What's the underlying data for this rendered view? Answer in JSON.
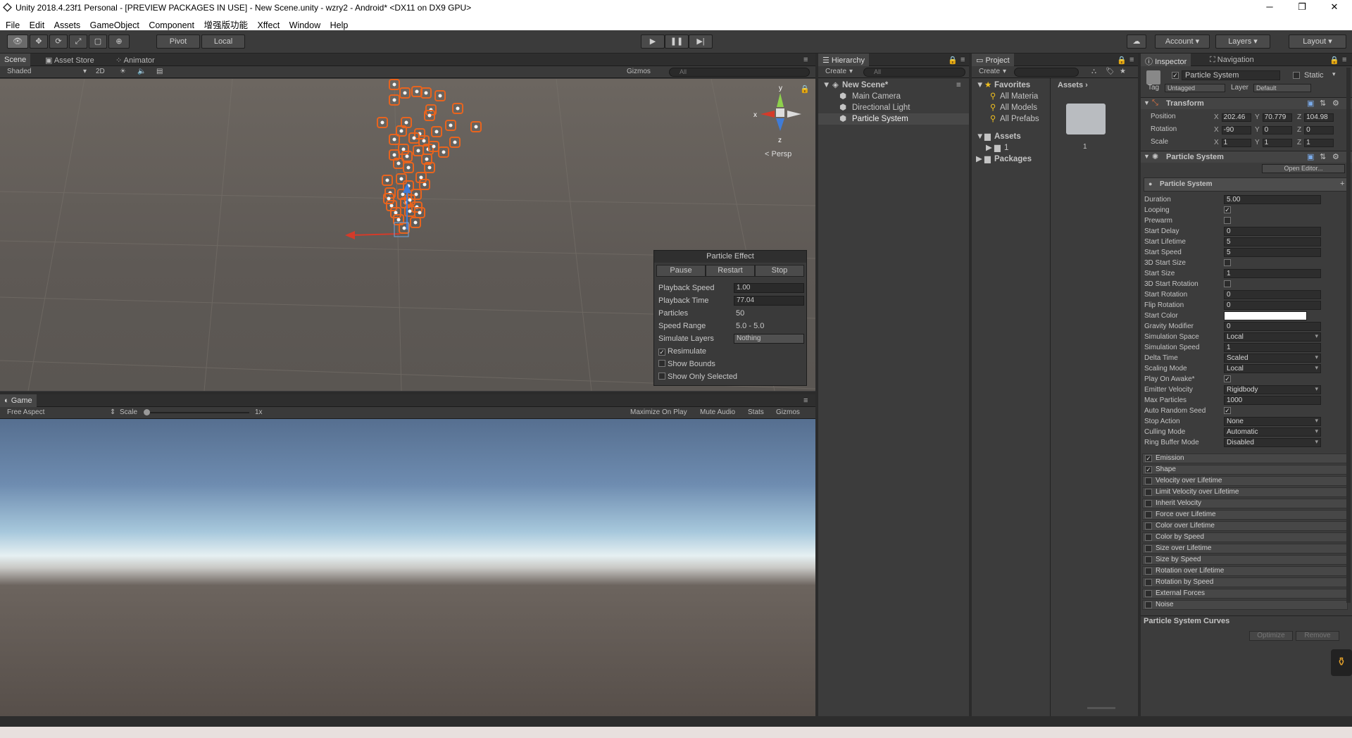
{
  "title": "Unity 2018.4.23f1 Personal - [PREVIEW PACKAGES IN USE] - New Scene.unity - wzry2 - Android* <DX11 on DX9 GPU>",
  "menu": [
    "File",
    "Edit",
    "Assets",
    "GameObject",
    "Component",
    "增强版功能",
    "Xffect",
    "Window",
    "Help"
  ],
  "toolbar": {
    "pivot": "Pivot",
    "local": "Local",
    "account": "Account",
    "layers": "Layers",
    "layout": "Layout"
  },
  "scene": {
    "tabs": [
      "Scene",
      "Asset Store",
      "Animator"
    ],
    "shading": "Shaded",
    "mode2d": "2D",
    "gizmos": "Gizmos",
    "search": "All",
    "persp": "Persp",
    "gizmo_axes": {
      "x": "x",
      "y": "y",
      "z": "z"
    }
  },
  "particle_effect": {
    "title": "Particle Effect",
    "buttons": [
      "Pause",
      "Restart",
      "Stop"
    ],
    "rows": [
      {
        "label": "Playback Speed",
        "value": "1.00"
      },
      {
        "label": "Playback Time",
        "value": "77.04"
      },
      {
        "label": "Particles",
        "value": "50"
      },
      {
        "label": "Speed Range",
        "value": "5.0 - 5.0"
      },
      {
        "label": "Simulate Layers",
        "value": "Nothing"
      }
    ],
    "checks": [
      {
        "label": "Resimulate",
        "checked": true
      },
      {
        "label": "Show Bounds",
        "checked": false
      },
      {
        "label": "Show Only Selected",
        "checked": false
      }
    ]
  },
  "game": {
    "tab": "Game",
    "aspect": "Free Aspect",
    "scale_label": "Scale",
    "scale_value": "1x",
    "options": [
      "Maximize On Play",
      "Mute Audio",
      "Stats",
      "Gizmos"
    ]
  },
  "hierarchy": {
    "tab": "Hierarchy",
    "create": "Create",
    "search": "All",
    "scene": "New Scene*",
    "items": [
      "Main Camera",
      "Directional Light",
      "Particle System"
    ],
    "selected": "Particle System"
  },
  "project": {
    "tab": "Project",
    "create": "Create",
    "favorites": "Favorites",
    "fav_items": [
      "All Materia",
      "All Models",
      "All Prefabs"
    ],
    "assets": "Assets",
    "asset_children": [
      "1"
    ],
    "packages": "Packages",
    "breadcrumb": "Assets",
    "folder_label": "1"
  },
  "inspector": {
    "tabs": [
      "Inspector",
      "Navigation"
    ],
    "object_name": "Particle System",
    "static": "Static",
    "tag_label": "Tag",
    "tag": "Untagged",
    "layer_label": "Layer",
    "layer": "Default",
    "transform": {
      "title": "Transform",
      "position": {
        "label": "Position",
        "x": "202.46",
        "y": "70.779",
        "z": "104.98"
      },
      "rotation": {
        "label": "Rotation",
        "x": "-90",
        "y": "0",
        "z": "0"
      },
      "scale": {
        "label": "Scale",
        "x": "1",
        "y": "1",
        "z": "1"
      }
    },
    "ps_title": "Particle System",
    "open_editor": "Open Editor...",
    "ps_main": "Particle System",
    "fields": [
      {
        "label": "Duration",
        "value": "5.00"
      },
      {
        "label": "Looping",
        "value": "✓"
      },
      {
        "label": "Prewarm",
        "value": ""
      },
      {
        "label": "Start Delay",
        "value": "0"
      },
      {
        "label": "Start Lifetime",
        "value": "5"
      },
      {
        "label": "Start Speed",
        "value": "5"
      },
      {
        "label": "3D Start Size",
        "value": ""
      },
      {
        "label": "Start Size",
        "value": "1"
      },
      {
        "label": "3D Start Rotation",
        "value": ""
      },
      {
        "label": "Start Rotation",
        "value": "0"
      },
      {
        "label": "Flip Rotation",
        "value": "0"
      },
      {
        "label": "Start Color",
        "value": ""
      },
      {
        "label": "Gravity Modifier",
        "value": "0"
      },
      {
        "label": "Simulation Space",
        "value": "Local"
      },
      {
        "label": "Simulation Speed",
        "value": "1"
      },
      {
        "label": "Delta Time",
        "value": "Scaled"
      },
      {
        "label": "Scaling Mode",
        "value": "Local"
      },
      {
        "label": "Play On Awake*",
        "value": "✓"
      },
      {
        "label": "Emitter Velocity",
        "value": "Rigidbody"
      },
      {
        "label": "Max Particles",
        "value": "1000"
      },
      {
        "label": "Auto Random Seed",
        "value": "✓"
      },
      {
        "label": "Stop Action",
        "value": "None"
      },
      {
        "label": "Culling Mode",
        "value": "Automatic"
      },
      {
        "label": "Ring Buffer Mode",
        "value": "Disabled"
      }
    ],
    "modules": [
      {
        "label": "Emission",
        "checked": true
      },
      {
        "label": "Shape",
        "checked": true
      },
      {
        "label": "Velocity over Lifetime",
        "checked": false
      },
      {
        "label": "Limit Velocity over Lifetime",
        "checked": false
      },
      {
        "label": "Inherit Velocity",
        "checked": false
      },
      {
        "label": "Force over Lifetime",
        "checked": false
      },
      {
        "label": "Color over Lifetime",
        "checked": false
      },
      {
        "label": "Color by Speed",
        "checked": false
      },
      {
        "label": "Size over Lifetime",
        "checked": false
      },
      {
        "label": "Size by Speed",
        "checked": false
      },
      {
        "label": "Rotation over Lifetime",
        "checked": false
      },
      {
        "label": "Rotation by Speed",
        "checked": false
      },
      {
        "label": "External Forces",
        "checked": false
      },
      {
        "label": "Noise",
        "checked": false
      }
    ],
    "curves": "Particle System Curves",
    "optimize": "Optimize",
    "remove": "Remove"
  },
  "colors": {
    "particle": "#e8641e",
    "accent": "#3e6ea8",
    "selection": "#484848"
  }
}
